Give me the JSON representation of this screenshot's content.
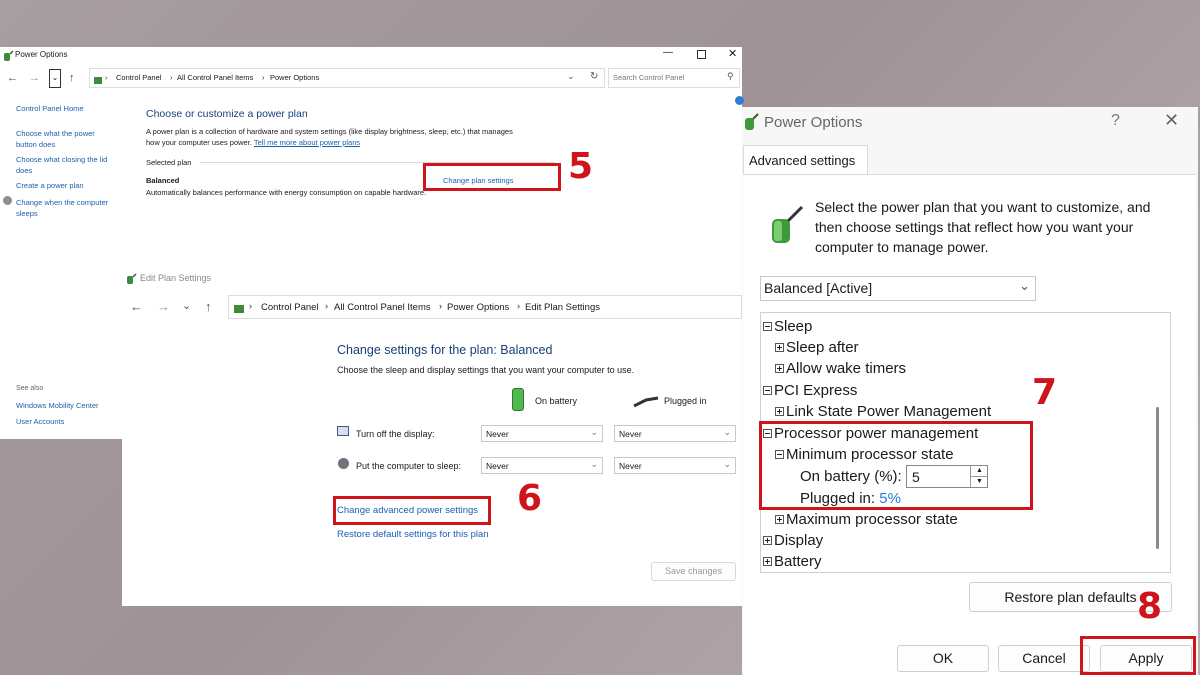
{
  "power_options": {
    "title": "Power Options",
    "nav": {
      "path": [
        "Control Panel",
        "All Control Panel Items",
        "Power Options"
      ],
      "search_placeholder": "Search Control Panel"
    },
    "sidebar": {
      "items": [
        "Control Panel Home",
        "Choose what the power button does",
        "Choose what closing the lid does",
        "Create a power plan",
        "Change when the computer sleeps"
      ],
      "see_also_heading": "See also",
      "see_also": [
        "Windows Mobility Center",
        "User Accounts"
      ]
    },
    "heading": "Choose or customize a power plan",
    "description": "A power plan is a collection of hardware and system settings (like display brightness, sleep, etc.) that manages how your computer uses power.",
    "learn_more": "Tell me more about power plans",
    "selected_plan_label": "Selected plan",
    "plan_name": "Balanced",
    "plan_description": "Automatically balances performance with energy consumption on capable hardware.",
    "change_plan_link": "Change plan settings"
  },
  "edit_plan": {
    "title": "Edit Plan Settings",
    "nav_path": [
      "Control Panel",
      "All Control Panel Items",
      "Power Options",
      "Edit Plan Settings"
    ],
    "heading": "Change settings for the plan: Balanced",
    "subheading": "Choose the sleep and display settings that you want your computer to use.",
    "col_battery": "On battery",
    "col_plugged": "Plugged in",
    "rows": [
      {
        "label": "Turn off the display:",
        "battery": "Never",
        "plugged": "Never"
      },
      {
        "label": "Put the computer to sleep:",
        "battery": "Never",
        "plugged": "Never"
      }
    ],
    "advanced_link": "Change advanced power settings",
    "restore_link": "Restore default settings for this plan",
    "save_button": "Save changes"
  },
  "advanced": {
    "title": "Power Options",
    "help_glyph": "?",
    "tab": "Advanced settings",
    "intro": "Select the power plan that you want to customize, and then choose settings that reflect how you want your computer to manage power.",
    "plan_select": "Balanced [Active]",
    "tree": {
      "sleep": "Sleep",
      "sleep_after": "Sleep after",
      "wake_timers": "Allow wake timers",
      "pci": "PCI Express",
      "link_state": "Link State Power Management",
      "processor": "Processor power management",
      "min_state": "Minimum processor state",
      "on_battery_label": "On battery (%):",
      "on_battery_value": "5",
      "plugged_label": "Plugged in:",
      "plugged_value": "5%",
      "max_state": "Maximum processor state",
      "display": "Display",
      "battery": "Battery"
    },
    "restore_button": "Restore plan defaults",
    "ok": "OK",
    "cancel": "Cancel",
    "apply": "Apply"
  },
  "steps": [
    "5",
    "6",
    "7",
    "8"
  ],
  "colors": {
    "highlight": "#d0141c",
    "link": "#1c5fb0",
    "heading": "#1a3f7a"
  }
}
